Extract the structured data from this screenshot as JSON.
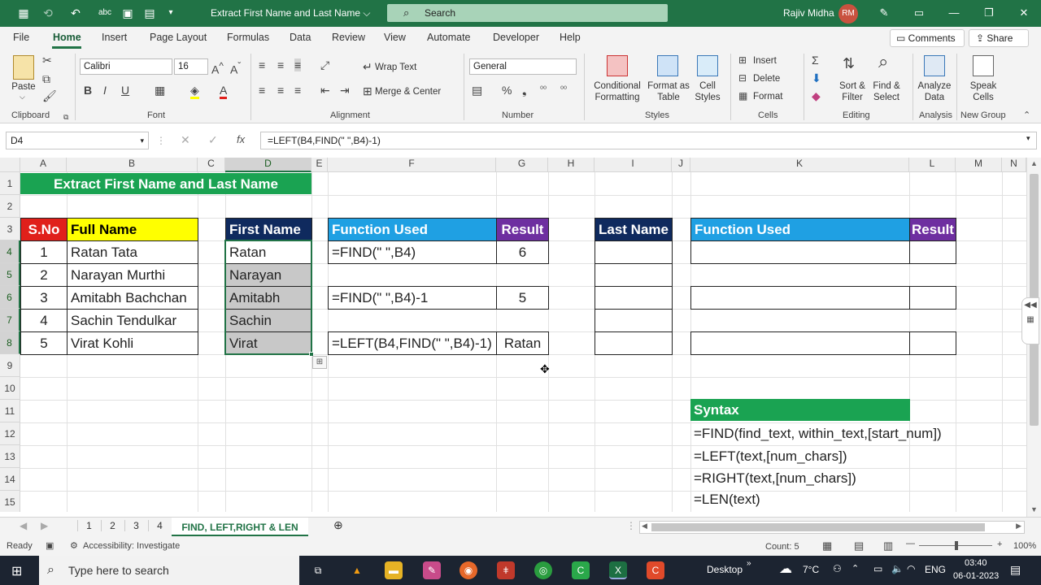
{
  "titlebar": {
    "doc_title": "Extract First Name and Last Name ⌵",
    "search_placeholder": "Search",
    "user_name": "Rajiv Midha",
    "user_initials": "RM"
  },
  "tabs": [
    "File",
    "Home",
    "Insert",
    "Page Layout",
    "Formulas",
    "Data",
    "Review",
    "View",
    "Automate",
    "Developer",
    "Help"
  ],
  "comments_label": "Comments",
  "share_label": "Share",
  "ribbon": {
    "paste": "Paste",
    "clipboard": "Clipboard",
    "font_name": "Calibri",
    "font_size": "16",
    "font": "Font",
    "wrap_text": "Wrap Text",
    "merge_center": "Merge & Center",
    "alignment": "Alignment",
    "number_format": "General",
    "number": "Number",
    "conditional_formatting": "Conditional Formatting",
    "format_as_table": "Format as Table",
    "cell_styles": "Cell Styles",
    "styles": "Styles",
    "insert": "Insert",
    "delete": "Delete",
    "format": "Format",
    "cells": "Cells",
    "sort_filter": "Sort & Filter",
    "find_select": "Find & Select",
    "editing": "Editing",
    "analyze_data": "Analyze Data",
    "analysis": "Analysis",
    "speak_cells": "Speak Cells",
    "new_group": "New Group"
  },
  "formula_bar": {
    "name_box": "D4",
    "formula": "=LEFT(B4,FIND(\" \",B4)-1)"
  },
  "columns": [
    "A",
    "B",
    "C",
    "D",
    "E",
    "F",
    "G",
    "H",
    "I",
    "J",
    "K",
    "L",
    "M",
    "N"
  ],
  "rows": [
    "1",
    "2",
    "3",
    "4",
    "5",
    "6",
    "7",
    "8",
    "9",
    "10",
    "11",
    "12",
    "13",
    "14",
    "15"
  ],
  "sheet": {
    "title": "Extract First Name and Last Name",
    "headers": {
      "sno": "S.No",
      "full_name": "Full Name",
      "first_name": "First Name",
      "function_used": "Function Used",
      "result": "Result",
      "last_name": "Last Name",
      "function_used_2": "Function Used",
      "result_2": "Result"
    },
    "data_rows": [
      {
        "sno": "1",
        "full_name": "Ratan Tata",
        "first_name": "Ratan"
      },
      {
        "sno": "2",
        "full_name": "Narayan Murthi",
        "first_name": "Narayan"
      },
      {
        "sno": "3",
        "full_name": "Amitabh Bachchan",
        "first_name": "Amitabh"
      },
      {
        "sno": "4",
        "full_name": "Sachin Tendulkar",
        "first_name": "Sachin"
      },
      {
        "sno": "5",
        "full_name": "Virat Kohli",
        "first_name": "Virat"
      }
    ],
    "functions": [
      {
        "formula": "=FIND(\" \",B4)",
        "result": "6"
      },
      {
        "formula": "=FIND(\" \",B4)-1",
        "result": "5"
      },
      {
        "formula": "=LEFT(B4,FIND(\" \",B4)-1)",
        "result": "Ratan"
      }
    ],
    "syntax_header": "Syntax",
    "syntax": [
      "=FIND(find_text, within_text,[start_num])",
      "=LEFT(text,[num_chars])",
      "=RIGHT(text,[num_chars])",
      "=LEN(text)"
    ]
  },
  "sheet_tabs": [
    "1",
    "2",
    "3",
    "4",
    "FIND, LEFT,RIGHT & LEN"
  ],
  "active_sheet": "FIND, LEFT,RIGHT & LEN",
  "status": {
    "ready": "Ready",
    "accessibility": "Accessibility: Investigate",
    "count": "Count: 5",
    "zoom": "100%"
  },
  "taskbar": {
    "search_placeholder": "Type here to search",
    "desktop": "Desktop",
    "temperature": "7°C",
    "language": "ENG",
    "time": "03:40",
    "date": "06-01-2023"
  },
  "colors": {
    "excel_green": "#217346",
    "title_green": "#1aa352",
    "sno_red": "#e0201b",
    "yellow": "#ffff00",
    "navy": "#0f2a5e",
    "blue": "#1fa0e3",
    "purple": "#6e2fa0",
    "syntax_green": "#1aa352",
    "selection_gray": "#c8c8c8"
  }
}
